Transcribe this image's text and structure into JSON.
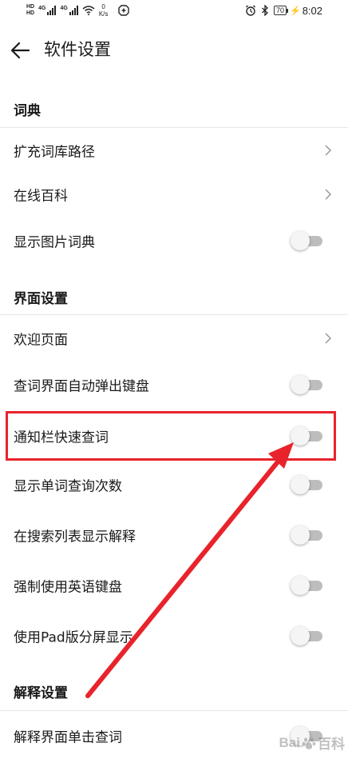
{
  "status_bar": {
    "sim1": "HD",
    "sim2": "HD",
    "net1": "4G",
    "net2": "4G",
    "speed_value": "0",
    "speed_unit": "K/s",
    "battery": "70",
    "time": "8:02"
  },
  "header": {
    "title": "软件设置"
  },
  "sections": [
    {
      "title": "词典",
      "items": [
        {
          "label": "扩充词库路径",
          "control": "chevron"
        },
        {
          "label": "在线百科",
          "control": "chevron"
        },
        {
          "label": "显示图片词典",
          "control": "toggle",
          "on": false
        }
      ]
    },
    {
      "title": "界面设置",
      "items": [
        {
          "label": "欢迎页面",
          "control": "chevron"
        },
        {
          "label": "查词界面自动弹出键盘",
          "control": "toggle",
          "on": false
        },
        {
          "label": "通知栏快速查词",
          "control": "toggle",
          "on": false
        },
        {
          "label": "显示单词查询次数",
          "control": "toggle",
          "on": false
        },
        {
          "label": "在搜索列表显示解释",
          "control": "toggle",
          "on": false
        },
        {
          "label": "强制使用英语键盘",
          "control": "toggle",
          "on": false
        },
        {
          "label": "使用Pad版分屏显示",
          "control": "toggle",
          "on": false
        }
      ]
    },
    {
      "title": "解释设置",
      "items": [
        {
          "label": "解释界面单击查词",
          "control": "toggle",
          "on": false
        }
      ]
    }
  ],
  "watermark": {
    "text_left": "Bai",
    "text_right": "百科"
  },
  "colors": {
    "annotation_red": "#e8232b",
    "toggle_off_track": "#bdbdbd",
    "toggle_knob": "#f5f5f5"
  }
}
